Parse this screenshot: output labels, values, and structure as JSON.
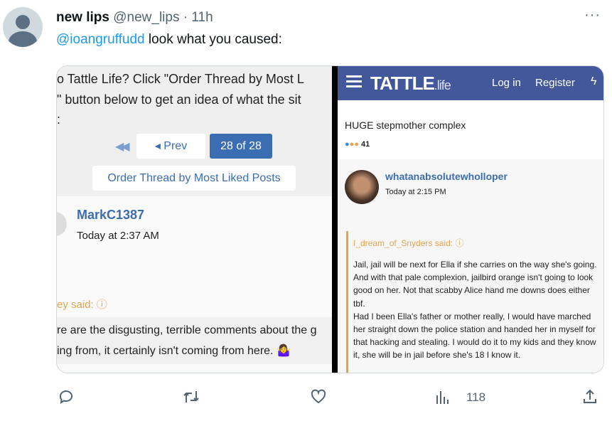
{
  "tweet": {
    "display_name": "new lips",
    "handle": "@new_lips",
    "separator": "·",
    "time": "11h",
    "mention": "@ioangruffudd",
    "text": " look what you caused:",
    "more_label": "···"
  },
  "left_screenshot": {
    "intro_lines": [
      "o Tattle Life? Click \"Order Thread by Most L",
      "\" button below to get an idea of what the sit",
      ":"
    ],
    "pagination": {
      "first_icon": "double-chevron-left",
      "prev_label": "◂ Prev",
      "current_label": "28 of 28"
    },
    "order_button": "Order Thread by Most Liked Posts",
    "post_author": "MarkC1387",
    "post_time": "Today at 2:37 AM",
    "quote_author": "ey said:",
    "quote_lines": [
      "re are the disgusting, terrible comments about the g",
      "ing from, it certainly isn't coming from here. 🤷‍♀️"
    ]
  },
  "right_screenshot": {
    "header": {
      "logo_main": "TATTLE",
      "logo_suffix": ".life",
      "login": "Log in",
      "register": "Register"
    },
    "post_text": "HUGE stepmother complex",
    "reaction_count": "41",
    "post_author": "whatanabsolutewholloper",
    "post_time": "Today at 2:15 PM",
    "quote_author": "I_dream_of_Snyders said:",
    "quote_text": "Jail, jail will be next for Ella if she carries on the way she's going. And with that pale complexion, jailbird orange isn't going to look good on her. Not that scabby Alice hand me downs does either tbf.",
    "quote_text2": "Had I been Ella's father or mother really, I would have marched her straight down the police station and handed her in myself for that hacking and stealing. I would do it to my kids and they know it, she will be in jail before she's 18 I know it."
  },
  "actions": {
    "views": "118"
  },
  "colors": {
    "link": "#1d9bf0",
    "tattle_blue": "#43589a",
    "quote_orange": "#e8a24a",
    "forum_link": "#3b6db2"
  }
}
